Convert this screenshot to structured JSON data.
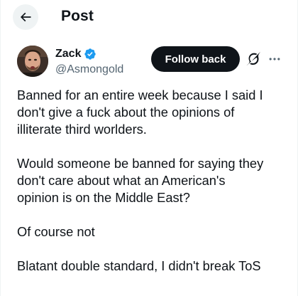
{
  "header": {
    "title": "Post"
  },
  "author": {
    "display_name": "Zack",
    "handle": "@Asmongold"
  },
  "actions": {
    "follow_label": "Follow back"
  },
  "post": {
    "lines": [
      "Banned for an entire week because I said I",
      "don't give a fuck about the opinions of",
      "illiterate third worlders.",
      "",
      "Would someone be banned for saying they",
      "don't care about what an American's",
      "opinion is on the Middle East?",
      "",
      "Of course not",
      "",
      "Blatant double standard, I didn't break ToS"
    ]
  },
  "colors": {
    "accent_verified": "#1d9bf0",
    "text_primary": "#0f1419",
    "text_secondary": "#536471",
    "button_dark": "#0f1419",
    "back_button_bg": "#eff3f4"
  },
  "icons": {
    "back": "arrow-left-icon",
    "verified": "verified-badge-icon",
    "grok": "grok-icon",
    "more": "more-horizontal-icon"
  }
}
